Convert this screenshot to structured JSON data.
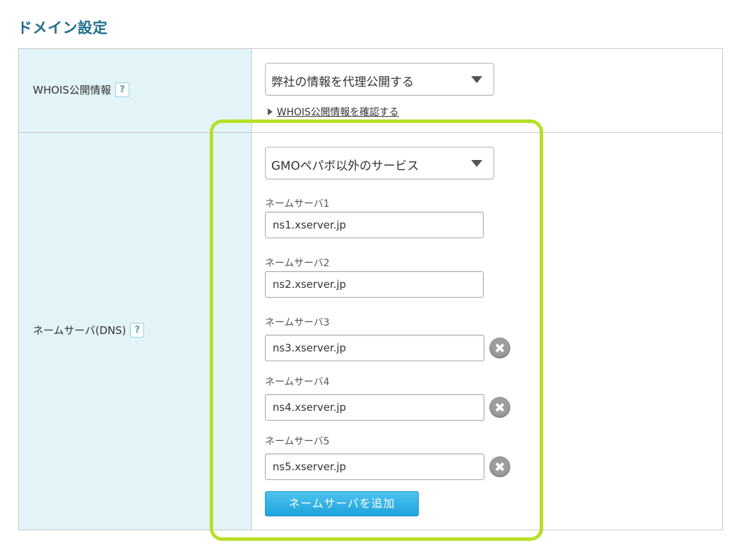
{
  "page": {
    "title": "ドメイン設定"
  },
  "whois": {
    "label": "WHOIS公開情報",
    "help": "?",
    "selected": "弊社の情報を代理公開する",
    "link": "WHOIS公開情報を確認する"
  },
  "nameserver": {
    "label": "ネームサーバ(DNS)",
    "help": "?",
    "selected": "GMOペパボ以外のサービス",
    "entries": [
      {
        "label": "ネームサーバ1",
        "value": "ns1.xserver.jp"
      },
      {
        "label": "ネームサーバ2",
        "value": "ns2.xserver.jp"
      },
      {
        "label": "ネームサーバ3",
        "value": "ns3.xserver.jp"
      },
      {
        "label": "ネームサーバ4",
        "value": "ns4.xserver.jp"
      },
      {
        "label": "ネームサーバ5",
        "value": "ns5.xserver.jp"
      }
    ],
    "add_button": "ネームサーバを追加"
  },
  "colors": {
    "title": "#1f6d8c",
    "label_bg": "#e2f4f8",
    "highlight": "#b7df2a",
    "button": "#1ea3dc"
  }
}
